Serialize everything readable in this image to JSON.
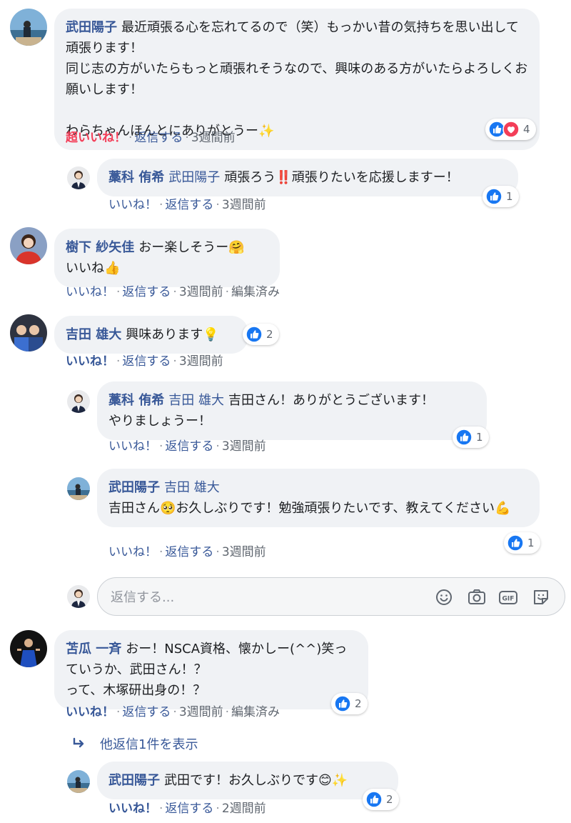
{
  "comments": [
    {
      "author": "武田陽子",
      "text": "最近頑張る心を忘れてるので（笑）もっかい昔の気持ちを思い出して頑張ります！\n同じ志の方がいたらもっと頑張れそうなので、興味のある方がいたらよろしくお願いします！\n\nわらちゃんほんとにありがとうー✨",
      "like_label": "超いいね！",
      "reply_label": "返信する",
      "time": "3週間前",
      "reaction_count": "4",
      "reaction_icons": [
        "like-icon",
        "love-icon"
      ]
    },
    {
      "author": "藁科 侑希",
      "mention": "武田陽子",
      "text": "頑張ろう‼️頑張りたいを応援しますー！",
      "like_label": "いいね！",
      "reply_label": "返信する",
      "time": "3週間前",
      "reaction_count": "1"
    },
    {
      "author": "樹下 紗矢佳",
      "text": "おー楽しそうー🤗\nいいね👍",
      "like_label": "いいね！",
      "reply_label": "返信する",
      "time": "3週間前",
      "edited": "編集済み"
    },
    {
      "author": "吉田 雄大",
      "text": "興味あります💡",
      "like_label": "いいね！",
      "reply_label": "返信する",
      "time": "3週間前",
      "reaction_count": "2"
    },
    {
      "author": "藁科 侑希",
      "mention": "吉田 雄大",
      "text": "吉田さん！ありがとうございます！\nやりましょうー！",
      "like_label": "いいね！",
      "reply_label": "返信する",
      "time": "3週間前",
      "reaction_count": "1"
    },
    {
      "author": "武田陽子",
      "mention": "吉田 雄大",
      "text": "吉田さん🥺お久しぶりです！勉強頑張りたいです、教えてください💪",
      "like_label": "いいね！",
      "reply_label": "返信する",
      "time": "3週間前",
      "reaction_count": "1"
    },
    {
      "author": "苫瓜 一斉",
      "text": "おー！NSCA資格、懐かしー(^^)笑っていうか、武田さん！？\nって、木塚研出身の！？",
      "like_label": "いいね！",
      "reply_label": "返信する",
      "time": "3週間前",
      "edited": "編集済み",
      "reaction_count": "2"
    },
    {
      "author": "武田陽子",
      "text": "武田です！お久しぶりです😊✨",
      "like_label": "いいね！",
      "reply_label": "返信する",
      "time": "2週間前",
      "reaction_count": "2"
    }
  ],
  "reply_box": {
    "placeholder": "返信する...",
    "tools": [
      "emoji-icon",
      "camera-icon",
      "gif-icon",
      "sticker-icon"
    ]
  },
  "more_replies_label": "他返信1件を表示",
  "colors": {
    "link": "#385898",
    "bubble": "#f0f2f5",
    "like_blue": "#1877f2",
    "love_red": "#f33e58",
    "meta_gray": "#606770"
  }
}
